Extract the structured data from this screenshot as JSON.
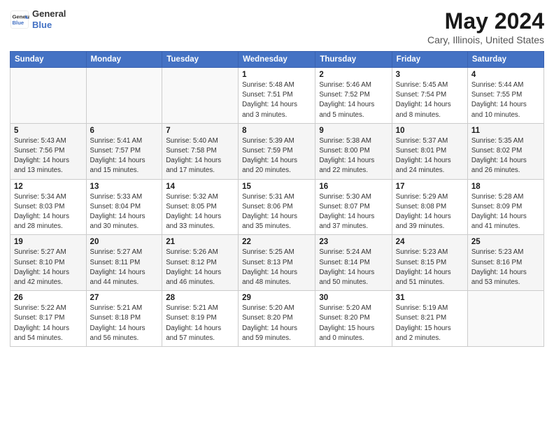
{
  "header": {
    "logo_line1": "General",
    "logo_line2": "Blue",
    "month": "May 2024",
    "location": "Cary, Illinois, United States"
  },
  "weekdays": [
    "Sunday",
    "Monday",
    "Tuesday",
    "Wednesday",
    "Thursday",
    "Friday",
    "Saturday"
  ],
  "weeks": [
    [
      {
        "day": "",
        "info": ""
      },
      {
        "day": "",
        "info": ""
      },
      {
        "day": "",
        "info": ""
      },
      {
        "day": "1",
        "info": "Sunrise: 5:48 AM\nSunset: 7:51 PM\nDaylight: 14 hours\nand 3 minutes."
      },
      {
        "day": "2",
        "info": "Sunrise: 5:46 AM\nSunset: 7:52 PM\nDaylight: 14 hours\nand 5 minutes."
      },
      {
        "day": "3",
        "info": "Sunrise: 5:45 AM\nSunset: 7:54 PM\nDaylight: 14 hours\nand 8 minutes."
      },
      {
        "day": "4",
        "info": "Sunrise: 5:44 AM\nSunset: 7:55 PM\nDaylight: 14 hours\nand 10 minutes."
      }
    ],
    [
      {
        "day": "5",
        "info": "Sunrise: 5:43 AM\nSunset: 7:56 PM\nDaylight: 14 hours\nand 13 minutes."
      },
      {
        "day": "6",
        "info": "Sunrise: 5:41 AM\nSunset: 7:57 PM\nDaylight: 14 hours\nand 15 minutes."
      },
      {
        "day": "7",
        "info": "Sunrise: 5:40 AM\nSunset: 7:58 PM\nDaylight: 14 hours\nand 17 minutes."
      },
      {
        "day": "8",
        "info": "Sunrise: 5:39 AM\nSunset: 7:59 PM\nDaylight: 14 hours\nand 20 minutes."
      },
      {
        "day": "9",
        "info": "Sunrise: 5:38 AM\nSunset: 8:00 PM\nDaylight: 14 hours\nand 22 minutes."
      },
      {
        "day": "10",
        "info": "Sunrise: 5:37 AM\nSunset: 8:01 PM\nDaylight: 14 hours\nand 24 minutes."
      },
      {
        "day": "11",
        "info": "Sunrise: 5:35 AM\nSunset: 8:02 PM\nDaylight: 14 hours\nand 26 minutes."
      }
    ],
    [
      {
        "day": "12",
        "info": "Sunrise: 5:34 AM\nSunset: 8:03 PM\nDaylight: 14 hours\nand 28 minutes."
      },
      {
        "day": "13",
        "info": "Sunrise: 5:33 AM\nSunset: 8:04 PM\nDaylight: 14 hours\nand 30 minutes."
      },
      {
        "day": "14",
        "info": "Sunrise: 5:32 AM\nSunset: 8:05 PM\nDaylight: 14 hours\nand 33 minutes."
      },
      {
        "day": "15",
        "info": "Sunrise: 5:31 AM\nSunset: 8:06 PM\nDaylight: 14 hours\nand 35 minutes."
      },
      {
        "day": "16",
        "info": "Sunrise: 5:30 AM\nSunset: 8:07 PM\nDaylight: 14 hours\nand 37 minutes."
      },
      {
        "day": "17",
        "info": "Sunrise: 5:29 AM\nSunset: 8:08 PM\nDaylight: 14 hours\nand 39 minutes."
      },
      {
        "day": "18",
        "info": "Sunrise: 5:28 AM\nSunset: 8:09 PM\nDaylight: 14 hours\nand 41 minutes."
      }
    ],
    [
      {
        "day": "19",
        "info": "Sunrise: 5:27 AM\nSunset: 8:10 PM\nDaylight: 14 hours\nand 42 minutes."
      },
      {
        "day": "20",
        "info": "Sunrise: 5:27 AM\nSunset: 8:11 PM\nDaylight: 14 hours\nand 44 minutes."
      },
      {
        "day": "21",
        "info": "Sunrise: 5:26 AM\nSunset: 8:12 PM\nDaylight: 14 hours\nand 46 minutes."
      },
      {
        "day": "22",
        "info": "Sunrise: 5:25 AM\nSunset: 8:13 PM\nDaylight: 14 hours\nand 48 minutes."
      },
      {
        "day": "23",
        "info": "Sunrise: 5:24 AM\nSunset: 8:14 PM\nDaylight: 14 hours\nand 50 minutes."
      },
      {
        "day": "24",
        "info": "Sunrise: 5:23 AM\nSunset: 8:15 PM\nDaylight: 14 hours\nand 51 minutes."
      },
      {
        "day": "25",
        "info": "Sunrise: 5:23 AM\nSunset: 8:16 PM\nDaylight: 14 hours\nand 53 minutes."
      }
    ],
    [
      {
        "day": "26",
        "info": "Sunrise: 5:22 AM\nSunset: 8:17 PM\nDaylight: 14 hours\nand 54 minutes."
      },
      {
        "day": "27",
        "info": "Sunrise: 5:21 AM\nSunset: 8:18 PM\nDaylight: 14 hours\nand 56 minutes."
      },
      {
        "day": "28",
        "info": "Sunrise: 5:21 AM\nSunset: 8:19 PM\nDaylight: 14 hours\nand 57 minutes."
      },
      {
        "day": "29",
        "info": "Sunrise: 5:20 AM\nSunset: 8:20 PM\nDaylight: 14 hours\nand 59 minutes."
      },
      {
        "day": "30",
        "info": "Sunrise: 5:20 AM\nSunset: 8:20 PM\nDaylight: 15 hours\nand 0 minutes."
      },
      {
        "day": "31",
        "info": "Sunrise: 5:19 AM\nSunset: 8:21 PM\nDaylight: 15 hours\nand 2 minutes."
      },
      {
        "day": "",
        "info": ""
      }
    ]
  ]
}
